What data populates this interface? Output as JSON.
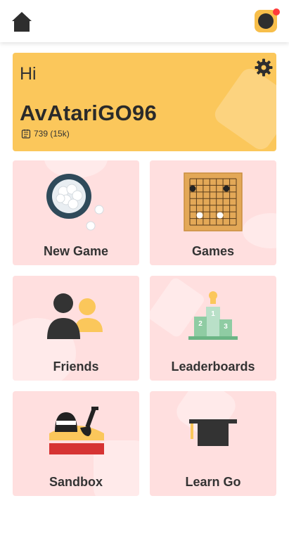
{
  "topbar": {
    "home_icon": "home-icon",
    "notification_icon": "notification-icon"
  },
  "profile": {
    "greeting": "Hi",
    "username": "AvAtariGO96",
    "rating": "739 (15k)",
    "settings_icon": "gear-icon"
  },
  "tiles": [
    {
      "label": "New Game",
      "icon": "go-stones-bowl-icon"
    },
    {
      "label": "Games",
      "icon": "go-board-icon"
    },
    {
      "label": "Friends",
      "icon": "friends-icon"
    },
    {
      "label": "Leaderboards",
      "icon": "podium-icon"
    },
    {
      "label": "Sandbox",
      "icon": "sandbox-icon"
    },
    {
      "label": "Learn Go",
      "icon": "graduation-cap-icon"
    }
  ],
  "colors": {
    "accent": "#fbc75b",
    "tile_bg": "#ffdfdf",
    "notification_dot": "#ff3b3b"
  }
}
